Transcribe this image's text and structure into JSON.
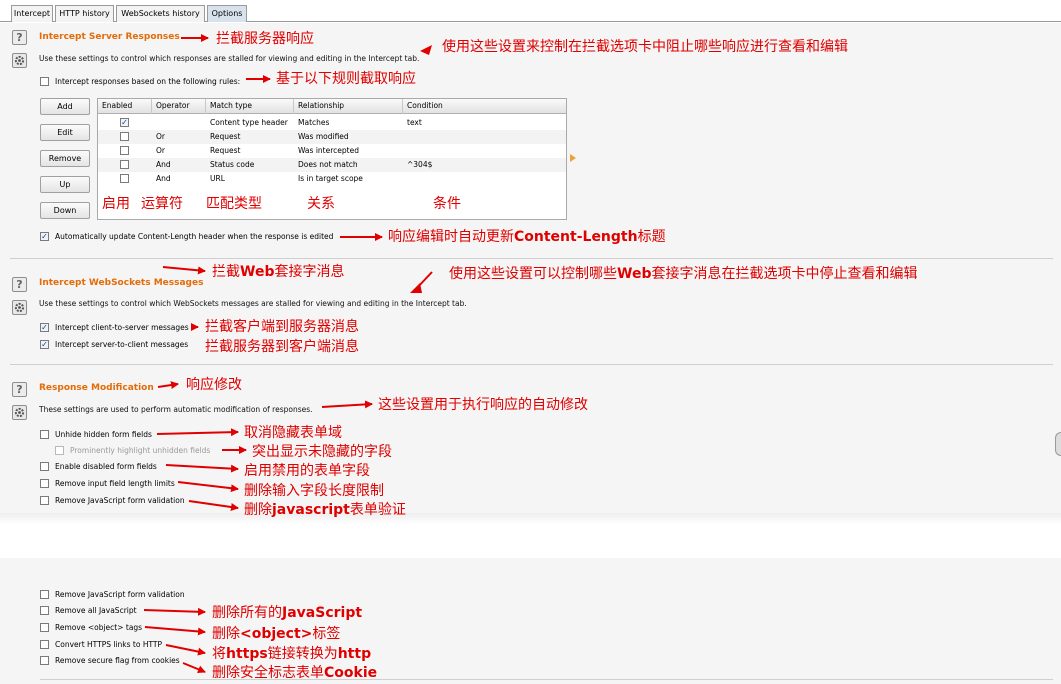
{
  "tabs": [
    {
      "label": "Intercept"
    },
    {
      "label": "HTTP history"
    },
    {
      "label": "WebSockets history"
    },
    {
      "label": "Options"
    }
  ],
  "server_responses": {
    "title": "Intercept Server Responses",
    "description": "Use these settings to control which responses are stalled for viewing and editing in the Intercept tab.",
    "rules_checkbox_label": "Intercept responses based on the following rules:",
    "buttons": {
      "add": "Add",
      "edit": "Edit",
      "remove": "Remove",
      "up": "Up",
      "down": "Down"
    },
    "columns": {
      "enabled": "Enabled",
      "operator": "Operator",
      "match_type": "Match type",
      "relationship": "Relationship",
      "condition": "Condition"
    },
    "rows": [
      {
        "enabled": true,
        "operator": "",
        "match_type": "Content type header",
        "relationship": "Matches",
        "condition": "text"
      },
      {
        "enabled": false,
        "operator": "Or",
        "match_type": "Request",
        "relationship": "Was modified",
        "condition": ""
      },
      {
        "enabled": false,
        "operator": "Or",
        "match_type": "Request",
        "relationship": "Was intercepted",
        "condition": ""
      },
      {
        "enabled": false,
        "operator": "And",
        "match_type": "Status code",
        "relationship": "Does not match",
        "condition": "^304$"
      },
      {
        "enabled": false,
        "operator": "And",
        "match_type": "URL",
        "relationship": "Is in target scope",
        "condition": ""
      }
    ],
    "auto_update_label": "Automatically update Content-Length header when the response is edited"
  },
  "websockets": {
    "title": "Intercept WebSockets Messages",
    "description": "Use these settings to control which WebSockets messages are stalled for viewing and editing in the Intercept tab.",
    "client_to_server": "Intercept client-to-server messages",
    "server_to_client": "Intercept server-to-client messages"
  },
  "response_mod": {
    "title": "Response Modification",
    "description": "These settings are used to perform automatic modification of responses.",
    "options": [
      "Unhide hidden form fields",
      "Prominently highlight unhidden fields",
      "Enable disabled form fields",
      "Remove input field length limits",
      "Remove JavaScript form validation"
    ],
    "options2": [
      "Remove JavaScript form validation",
      "Remove all JavaScript",
      "Remove <object> tags",
      "Convert HTTPS links to HTTP",
      "Remove secure flag from cookies"
    ]
  },
  "notes": {
    "server_title": "拦截服务器响应",
    "server_desc": "使用这些设置来控制在拦截选项卡中阻止哪些响应进行查看和编辑",
    "rules": "基于以下规则截取响应",
    "col_enabled": "启用",
    "col_operator": "运算符",
    "col_match": "匹配类型",
    "col_relationship": "关系",
    "col_condition": "条件",
    "auto_update_pre": "响应编辑时自动更新",
    "auto_update_bold": "Content-Length",
    "auto_update_post": "标题",
    "ws_title_pre": "拦截",
    "ws_title_bold": "Web",
    "ws_title_post": "套接字消息",
    "ws_desc_pre": "使用这些设置可以控制哪些",
    "ws_desc_bold": "Web",
    "ws_desc_post": "套接字消息在拦截选项卡中停止查看和编辑",
    "c2s": "拦截客户端到服务器消息",
    "s2c": "拦截服务器到客户端消息",
    "mod_title": "响应修改",
    "mod_desc": "这些设置用于执行响应的自动修改",
    "unhide": "取消隐藏表单域",
    "highlight": "突出显示未隐藏的字段",
    "enable_disabled": "启用禁用的表单字段",
    "remove_length": "删除输入字段长度限制",
    "remove_js_val_pre": "删除",
    "remove_js_val_bold": "javascript",
    "remove_js_val_post": "表单验证",
    "remove_all_js_pre": "删除所有的",
    "remove_all_js_bold": "JavaScript",
    "remove_object_pre": "删除",
    "remove_object_bold": "<object>",
    "remove_object_post": "标签",
    "convert_pre": "将",
    "convert_bold1": "https",
    "convert_mid": "链接转换为",
    "convert_bold2": "http",
    "secure_pre": "删除安全标志表单",
    "secure_bold": "Cookie"
  },
  "colors": {
    "accent": "#e36c09",
    "annotation": "#e00000",
    "panel_bg": "#f5f5f5"
  }
}
